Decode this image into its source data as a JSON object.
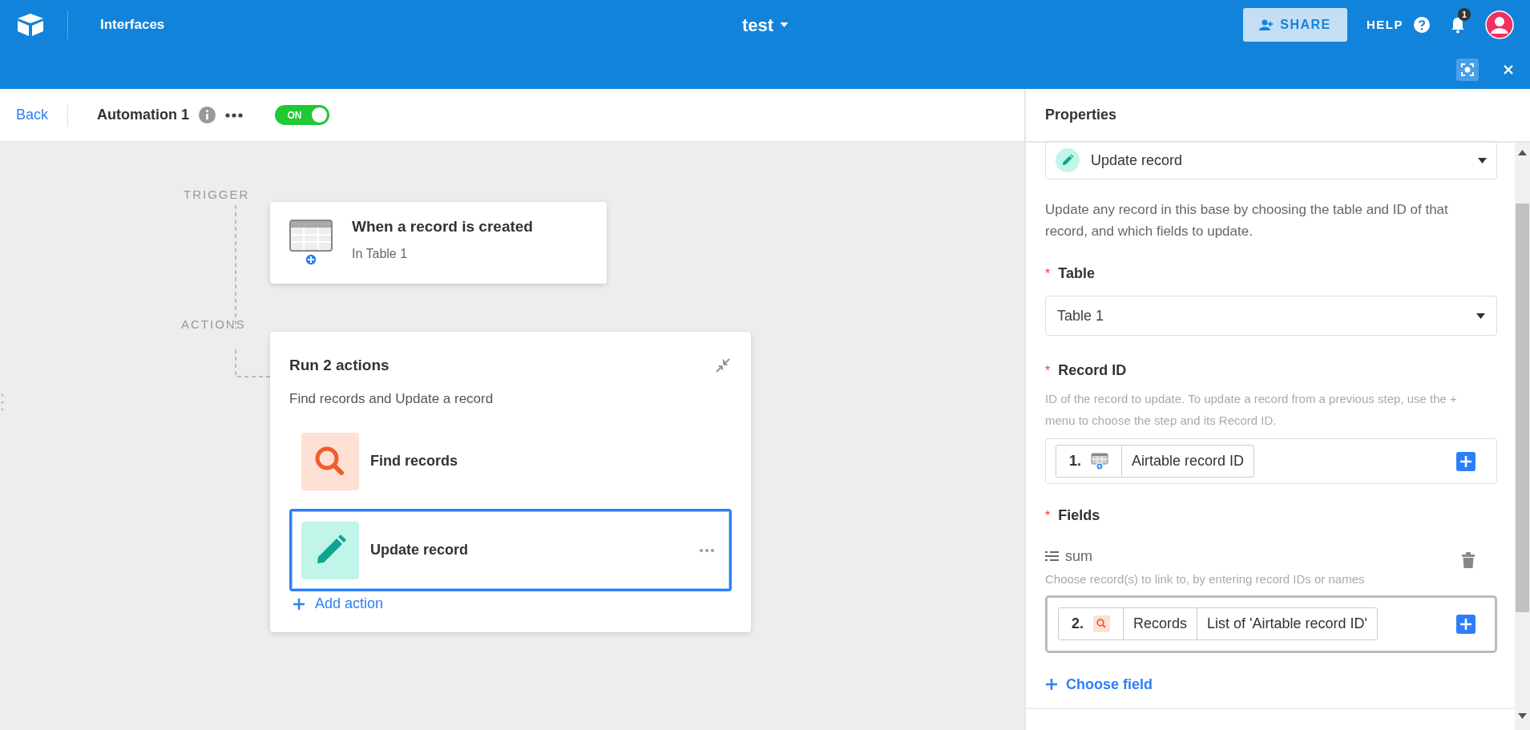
{
  "topbar": {
    "section_label": "Interfaces",
    "base_title": "test",
    "share_label": "SHARE",
    "help_label": "HELP",
    "notification_count": "1"
  },
  "toolbar": {
    "back_label": "Back",
    "automation_name": "Automation 1",
    "toggle": {
      "label": "ON",
      "on": true
    }
  },
  "canvas": {
    "trigger_section_label": "TRIGGER",
    "trigger": {
      "title": "When a record is created",
      "subtitle": "In Table 1"
    },
    "actions_section_label": "ACTIONS",
    "actions_group": {
      "title": "Run 2 actions",
      "description": "Find records and Update a record",
      "actions": [
        {
          "kind": "find",
          "label": "Find records",
          "selected": false
        },
        {
          "kind": "update",
          "label": "Update record",
          "selected": true
        }
      ],
      "add_label": "Add action"
    }
  },
  "properties": {
    "title": "Properties",
    "action_type": "Update record",
    "description": "Update any record in this base by choosing the table and ID of that record, and which fields to update.",
    "table": {
      "label": "Table",
      "required_mark": "*",
      "value": "Table 1"
    },
    "record_id": {
      "label": "Record ID",
      "required_mark": "*",
      "help": "ID of the record to update. To update a record from a previous step, use the + menu to choose the step and its Record ID.",
      "token": {
        "step": "1.",
        "kind": "trigger",
        "parts": [
          "Airtable record ID"
        ]
      }
    },
    "fields": {
      "label": "Fields",
      "required_mark": "*",
      "items": [
        {
          "name": "sum",
          "help": "Choose record(s) to link to, by entering record IDs or names",
          "token": {
            "step": "2.",
            "kind": "find",
            "parts": [
              "Records",
              "List of 'Airtable record ID'"
            ]
          }
        }
      ],
      "add_label": "Choose field"
    }
  }
}
